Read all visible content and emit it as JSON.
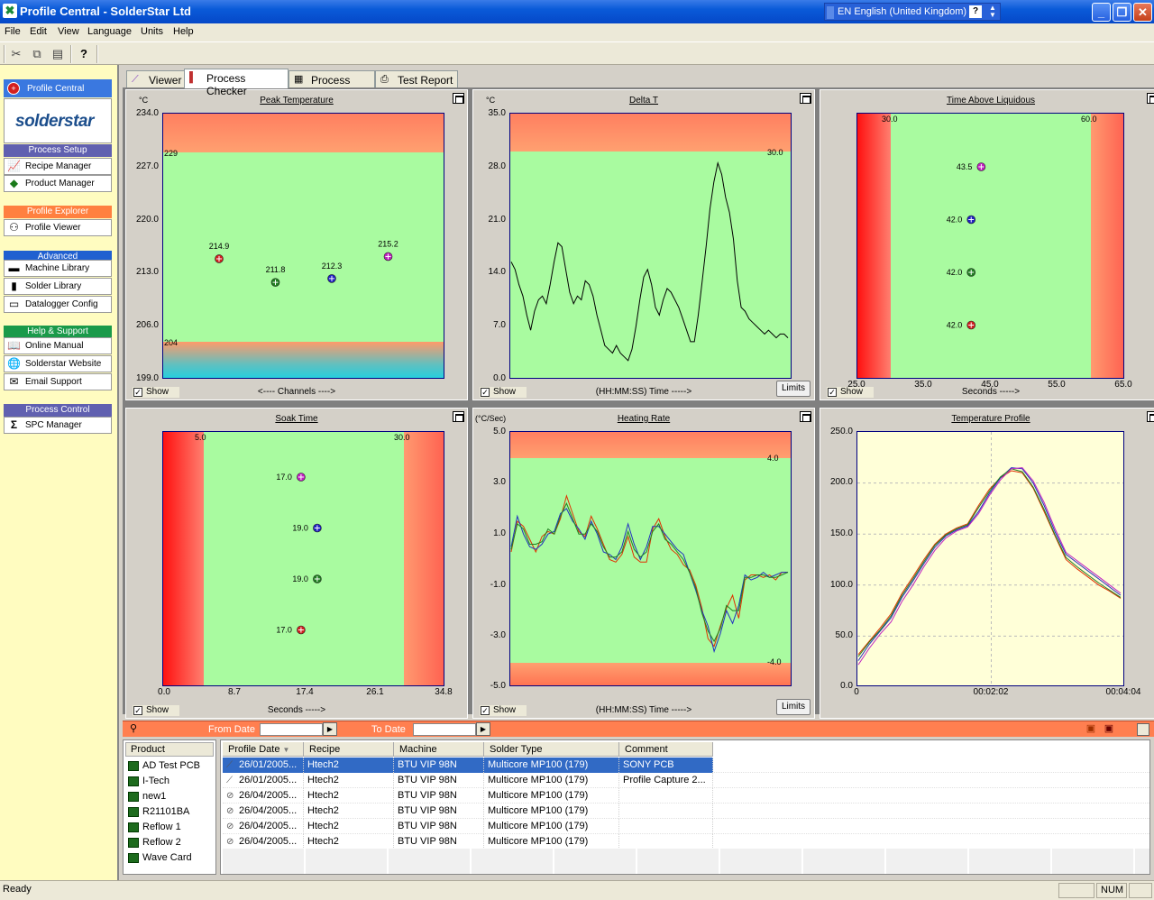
{
  "window": {
    "title": "Profile Central - SolderStar Ltd",
    "language": "EN English (United Kingdom)"
  },
  "menu": [
    "File",
    "Edit",
    "View",
    "Language",
    "Units",
    "Help"
  ],
  "sidebar": {
    "top_label": "Profile Central",
    "logo_text": "solderstar",
    "sections": [
      {
        "title": "Process Setup",
        "color": "#6060b0",
        "items": [
          "Recipe Manager",
          "Product Manager"
        ]
      },
      {
        "title": "Profile Explorer",
        "color": "#ff8040",
        "items": [
          "Profile Viewer"
        ]
      },
      {
        "title": "Advanced",
        "color": "#2060d0",
        "items": [
          "Machine Library",
          "Solder Library",
          "Datalogger Config"
        ]
      },
      {
        "title": "Help & Support",
        "color": "#1a9a4a",
        "items": [
          "Online Manual",
          "Solderstar Website",
          "Email Support"
        ]
      },
      {
        "title": "Process Control",
        "color": "#6060b0",
        "items": [
          "SPC Manager"
        ]
      }
    ]
  },
  "tabs": [
    "Viewer",
    "Process Checker",
    "Process Data",
    "Test Report"
  ],
  "active_tab": "Process Checker",
  "panels": {
    "peak": {
      "title": "Peak Temperature",
      "unit": "°C",
      "xtitle": "<---- Channels ---->",
      "show": "Show",
      "yticks": [
        "234.0",
        "227.0",
        "220.0",
        "213.0",
        "206.0",
        "199.0"
      ],
      "limits": [
        "229",
        "204"
      ]
    },
    "delta": {
      "title": "Delta T",
      "unit": "°C",
      "xtitle": "(HH:MM:SS) Time ----->",
      "show": "Show",
      "limits_btn": "Limits",
      "yticks": [
        "35.0",
        "28.0",
        "21.0",
        "14.0",
        "7.0",
        "0.0"
      ],
      "limit": "30.0"
    },
    "tal": {
      "title": "Time Above Liquidous",
      "xtitle": "Seconds ----->",
      "show": "Show",
      "xticks": [
        "25.0",
        "35.0",
        "45.0",
        "55.0",
        "65.0"
      ],
      "limits": [
        "30.0",
        "60.0"
      ]
    },
    "soak": {
      "title": "Soak Time",
      "xtitle": "Seconds ----->",
      "show": "Show",
      "xticks": [
        "0.0",
        "8.7",
        "17.4",
        "26.1",
        "34.8"
      ],
      "limits": [
        "5.0",
        "30.0"
      ]
    },
    "rate": {
      "title": "Heating Rate",
      "unit": "(°C/Sec)",
      "xtitle": "(HH:MM:SS) Time ----->",
      "show": "Show",
      "limits_btn": "Limits",
      "yticks": [
        "5.0",
        "3.0",
        "1.0",
        "-1.0",
        "-3.0",
        "-5.0"
      ],
      "limits": [
        "4.0",
        "-4.0"
      ]
    },
    "profile": {
      "title": "Temperature Profile",
      "yticks": [
        "250.0",
        "200.0",
        "150.0",
        "100.0",
        "50.0",
        "0.0"
      ],
      "xticks": [
        "0",
        "00:02:02",
        "00:04:04"
      ]
    }
  },
  "chart_data": [
    {
      "type": "scatter",
      "title": "Peak Temperature",
      "ylabel": "°C",
      "ylim": [
        199,
        234
      ],
      "upper_limit": 229,
      "lower_limit": 204,
      "series": [
        {
          "color": "#d02020",
          "x": [
            1
          ],
          "y": [
            214.9
          ]
        },
        {
          "color": "#208020",
          "x": [
            2
          ],
          "y": [
            211.8
          ]
        },
        {
          "color": "#2020c0",
          "x": [
            3
          ],
          "y": [
            212.3
          ]
        },
        {
          "color": "#c020c0",
          "x": [
            4
          ],
          "y": [
            215.2
          ]
        }
      ]
    },
    {
      "type": "line",
      "title": "Delta T",
      "ylabel": "°C",
      "ylim": [
        0,
        35
      ],
      "upper_limit": 30.0,
      "series": [
        {
          "color": "#000000",
          "values": [
            15.5,
            14.5,
            12.5,
            11,
            8.5,
            6.5,
            9,
            10.5,
            11,
            10,
            12.5,
            15.5,
            18,
            17.5,
            14.5,
            11.5,
            10,
            11,
            10.5,
            13,
            12.5,
            11,
            8.5,
            6.5,
            4.5,
            4,
            3.5,
            4.5,
            3.5,
            3,
            2.5,
            4,
            7,
            10.5,
            13.5,
            14.5,
            12.5,
            9.5,
            8.5,
            10.5,
            12,
            11.5,
            10.5,
            9.5,
            8,
            6.5,
            5,
            5,
            8.5,
            13,
            17.5,
            22.5,
            26,
            28.5,
            27,
            24,
            22,
            18.5,
            13,
            9.5,
            9,
            8,
            7.5,
            7,
            6.5,
            6,
            6.5,
            6,
            5.5,
            6,
            6,
            5.5
          ]
        }
      ]
    },
    {
      "type": "scatter",
      "title": "Time Above Liquidous",
      "xlabel": "Seconds",
      "xlim": [
        25,
        65
      ],
      "limits": [
        30,
        60
      ],
      "series": [
        {
          "color": "#c020c0",
          "x": [
            43.5
          ]
        },
        {
          "color": "#2020c0",
          "x": [
            42.0
          ]
        },
        {
          "color": "#208020",
          "x": [
            42.0
          ]
        },
        {
          "color": "#d02020",
          "x": [
            42.0
          ]
        }
      ]
    },
    {
      "type": "scatter",
      "title": "Soak Time",
      "xlabel": "Seconds",
      "xlim": [
        0,
        34.8
      ],
      "limits": [
        5,
        30
      ],
      "series": [
        {
          "color": "#c020c0",
          "x": [
            17.0
          ]
        },
        {
          "color": "#2020c0",
          "x": [
            19.0
          ]
        },
        {
          "color": "#208020",
          "x": [
            19.0
          ]
        },
        {
          "color": "#d02020",
          "x": [
            17.0
          ]
        }
      ]
    },
    {
      "type": "line",
      "title": "Heating Rate",
      "ylabel": "(°C/Sec)",
      "ylim": [
        -5,
        5
      ],
      "upper_limit": 4.0,
      "lower_limit": -4.0,
      "series": [
        {
          "color": "#e03000",
          "values": [
            0.3,
            1.5,
            1.3,
            0.8,
            0.3,
            0.9,
            1.1,
            1.0,
            1.6,
            2.5,
            1.8,
            1.1,
            0.9,
            1.7,
            1.2,
            0.6,
            0.0,
            -0.1,
            0.2,
            0.9,
            0.1,
            -0.1,
            -0.1,
            1.2,
            1.6,
            0.9,
            0.4,
            0.2,
            -0.2,
            -0.4,
            -1.0,
            -1.9,
            -3.1,
            -3.4,
            -2.6,
            -1.9,
            -1.4,
            -2.3,
            -0.8,
            -0.6,
            -0.6,
            -0.7,
            -0.6,
            -0.8,
            -0.5,
            -0.5
          ]
        },
        {
          "color": "#2030c0",
          "values": [
            0.5,
            1.7,
            1.0,
            0.5,
            0.4,
            0.6,
            1.0,
            1.1,
            1.8,
            2.0,
            1.5,
            1.2,
            0.8,
            1.5,
            1.0,
            0.3,
            0.2,
            0.0,
            0.5,
            1.4,
            0.6,
            0.0,
            0.5,
            1.3,
            1.3,
            1.0,
            0.7,
            0.4,
            0.2,
            -0.5,
            -1.2,
            -2.0,
            -2.6,
            -3.6,
            -2.9,
            -2.0,
            -2.5,
            -1.8,
            -0.6,
            -0.8,
            -0.7,
            -0.5,
            -0.7,
            -0.6,
            -0.5,
            -0.5
          ]
        },
        {
          "color": "#208020",
          "values": [
            0.4,
            1.4,
            1.2,
            0.6,
            0.6,
            0.7,
            1.2,
            1.0,
            1.7,
            2.2,
            1.6,
            1.0,
            1.0,
            1.4,
            1.1,
            0.5,
            0.1,
            0.1,
            0.3,
            1.1,
            0.4,
            0.1,
            0.3,
            1.1,
            1.4,
            0.8,
            0.6,
            0.3,
            0.0,
            -0.5,
            -1.1,
            -2.1,
            -2.8,
            -3.2,
            -2.7,
            -1.8,
            -2.0,
            -2.0,
            -0.7,
            -0.7,
            -0.6,
            -0.6,
            -0.7,
            -0.7,
            -0.6,
            -0.5
          ]
        }
      ]
    },
    {
      "type": "line",
      "title": "Temperature Profile",
      "ylim": [
        0,
        250
      ],
      "xticks": [
        "0",
        "00:02:02",
        "00:04:04"
      ],
      "series": [
        {
          "color": "#e03000",
          "values": [
            32,
            45,
            58,
            72,
            92,
            108,
            125,
            140,
            150,
            156,
            160,
            178,
            194,
            205,
            212,
            210,
            195,
            172,
            148,
            125,
            116,
            108,
            100,
            94,
            87
          ]
        },
        {
          "color": "#2030c0",
          "values": [
            26,
            42,
            55,
            68,
            88,
            104,
            121,
            137,
            148,
            154,
            158,
            172,
            190,
            205,
            215,
            214,
            200,
            178,
            152,
            130,
            122,
            114,
            106,
            98,
            90
          ]
        },
        {
          "color": "#208020",
          "values": [
            30,
            44,
            56,
            70,
            90,
            106,
            123,
            139,
            149,
            155,
            159,
            176,
            192,
            206,
            214,
            211,
            196,
            174,
            149,
            127,
            118,
            110,
            102,
            95,
            88
          ]
        },
        {
          "color": "#c020c0",
          "values": [
            22,
            38,
            52,
            64,
            84,
            100,
            118,
            134,
            146,
            153,
            157,
            170,
            188,
            203,
            214,
            215,
            202,
            181,
            155,
            132,
            124,
            116,
            108,
            100,
            92
          ]
        }
      ]
    }
  ],
  "bottom": {
    "from_label": "From Date",
    "to_label": "To Date"
  },
  "products": {
    "header": "Product",
    "items": [
      "AD Test PCB",
      "I-Tech",
      "new1",
      "R21101BA",
      "Reflow 1",
      "Reflow 2",
      "Wave Card"
    ]
  },
  "profiles": {
    "columns": [
      "Profile Date",
      "Recipe",
      "Machine",
      "Solder Type",
      "Comment"
    ],
    "rows": [
      [
        "26/01/2005...",
        "Htech2",
        "BTU VIP 98N",
        "Multicore MP100 (179)",
        "SONY PCB"
      ],
      [
        "26/01/2005...",
        "Htech2",
        "BTU VIP 98N",
        "Multicore MP100 (179)",
        "Profile Capture 2..."
      ],
      [
        "26/04/2005...",
        "Htech2",
        "BTU VIP 98N",
        "Multicore MP100 (179)",
        ""
      ],
      [
        "26/04/2005...",
        "Htech2",
        "BTU VIP 98N",
        "Multicore MP100 (179)",
        ""
      ],
      [
        "26/04/2005...",
        "Htech2",
        "BTU VIP 98N",
        "Multicore MP100 (179)",
        ""
      ],
      [
        "26/04/2005...",
        "Htech2",
        "BTU VIP 98N",
        "Multicore MP100 (179)",
        ""
      ]
    ]
  },
  "status": {
    "text": "Ready",
    "num": "NUM"
  }
}
